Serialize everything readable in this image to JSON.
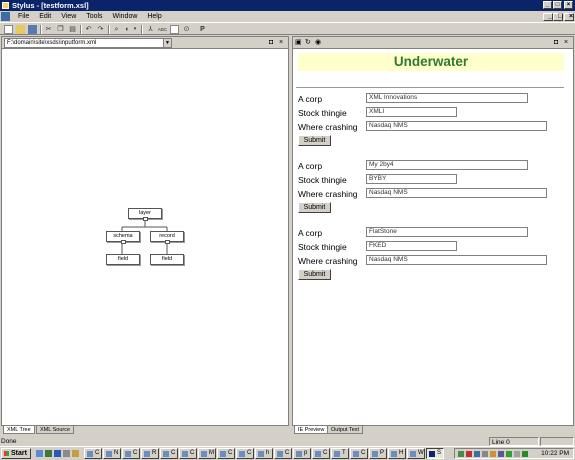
{
  "window": {
    "title": "Stylus - [testform.xsl]",
    "controls": [
      "_",
      "□",
      "×"
    ],
    "doc_controls": [
      "_",
      "□",
      "×"
    ]
  },
  "menu": [
    "File",
    "Edit",
    "View",
    "Tools",
    "Window",
    "Help"
  ],
  "toolbar": {
    "icons": [
      "new-icon",
      "open-icon",
      "save-icon",
      "cut-icon",
      "copy-icon",
      "paste-icon",
      "undo-icon",
      "redo-icon",
      "find-icon",
      "format-icon",
      "tree-icon",
      "spellcheck-icon",
      "schema-icon",
      "xpath-icon",
      "run-icon",
      "dropdown-icon",
      "breakpoint-icon",
      "debug-icon",
      "profile-icon"
    ],
    "labels": [
      "ABC",
      "P"
    ]
  },
  "left_pane": {
    "path": "F:\\domain\\site\\xsds\\inputform.xml",
    "tabs": [
      {
        "label": "XML Tree",
        "active": true
      },
      {
        "label": "XML Source",
        "active": false
      }
    ],
    "tree": {
      "root": "layer",
      "children": [
        {
          "label": "schema",
          "child": "field"
        },
        {
          "label": "record",
          "child": "field"
        }
      ]
    }
  },
  "right_pane": {
    "tabs": [
      {
        "label": "IE Preview",
        "active": true
      },
      {
        "label": "Output Text",
        "active": false
      }
    ],
    "heading": "Underwater",
    "heading_bg": "#ffffcc",
    "heading_color": "#2f7a2f",
    "forms": [
      {
        "corp_label": "A corp",
        "corp": "XML Innovations",
        "stock_label": "Stock thingie",
        "stock": "XMLI",
        "where_label": "Where crashing",
        "where": "Nasdaq NMS",
        "submit": "Submit"
      },
      {
        "corp_label": "A corp",
        "corp": "My 2by4",
        "stock_label": "Stock thingie",
        "stock": "BYBY",
        "where_label": "Where crashing",
        "where": "Nasdaq NMS",
        "submit": "Submit"
      },
      {
        "corp_label": "A corp",
        "corp": "FlatStone",
        "stock_label": "Stock thingie",
        "stock": "FKED",
        "where_label": "Where crashing",
        "where": "Nasdaq NMS",
        "submit": "Submit"
      }
    ]
  },
  "status": {
    "left": "Done",
    "line": "Line 0"
  },
  "taskbar": {
    "start": "Start",
    "buttons": [
      "C",
      "N",
      "C",
      "R",
      "C",
      "C",
      "M",
      "C",
      "C",
      "h",
      "C",
      "p",
      "C",
      "T",
      "C",
      "P",
      "H",
      "W",
      "S"
    ],
    "clock": "10:22 PM"
  }
}
